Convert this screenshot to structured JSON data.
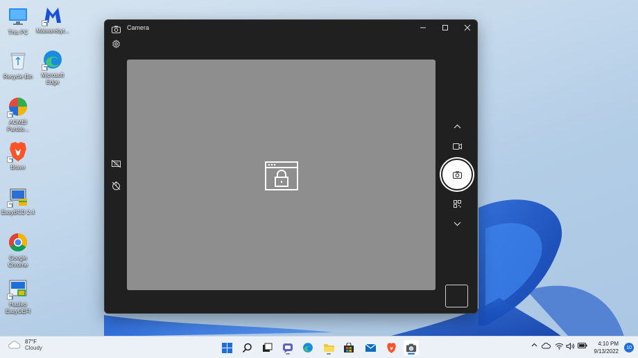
{
  "desktop": {
    "icons": [
      {
        "label": "This PC",
        "icon": "monitor-icon"
      },
      {
        "label": "Malwarebyt...",
        "icon": "malwarebytes-icon"
      },
      {
        "label": "Recycle Bin",
        "icon": "recycle-bin-icon"
      },
      {
        "label": "Microsoft\nEdge",
        "icon": "edge-icon"
      },
      {
        "label": "AOMEI\nPartitio...",
        "icon": "aomei-icon"
      },
      {
        "label": "Brave",
        "icon": "brave-icon"
      },
      {
        "label": "EasyBCD 2.4",
        "icon": "easybcd-icon"
      },
      {
        "label": "Google\nChrome",
        "icon": "chrome-icon"
      },
      {
        "label": "Hasleo\nEasyUEFI",
        "icon": "easyuefi-icon"
      }
    ]
  },
  "camera_window": {
    "title": "Camera",
    "preview_state": "camera-access-blocked",
    "controls": [
      "settings",
      "hdr-off",
      "timer-off",
      "mode-up",
      "video-mode",
      "photo-capture",
      "qr-scan",
      "mode-down",
      "last-capture-thumbnail"
    ]
  },
  "taskbar": {
    "weather": {
      "temp": "87°F",
      "condition": "Cloudy"
    },
    "apps": [
      "start",
      "search",
      "task-view",
      "chat",
      "edge",
      "file-explorer",
      "store",
      "mail",
      "brave",
      "camera"
    ],
    "active_app": "camera",
    "clock": {
      "time": "4:10 PM",
      "date": "9/13/2022"
    },
    "notification_count": "10"
  },
  "colors": {
    "window_bg": "#202020",
    "preview_bg": "#8e8e8e",
    "accent": "#1e6fd9",
    "wallpaper": "#b3cde6"
  }
}
